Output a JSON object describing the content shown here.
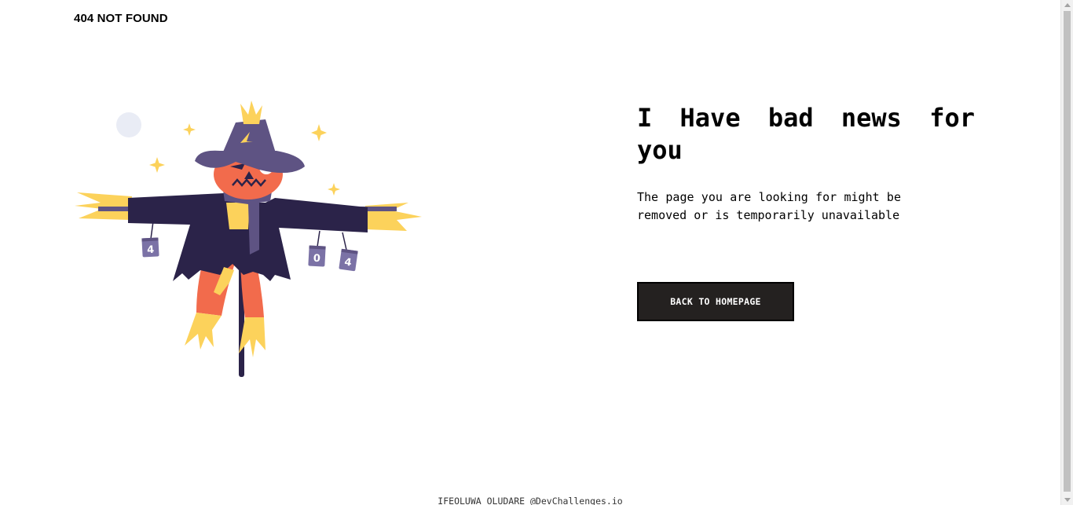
{
  "header": {
    "brand": "404 NOT FOUND"
  },
  "illustration": {
    "name": "scarecrow-illustration",
    "can_labels": [
      "4",
      "0",
      "4"
    ]
  },
  "main": {
    "headline": "I Have bad news for you",
    "message": "The page you are looking for might be removed or is temporarily unavailable",
    "cta_label": "BACK TO HOMEPAGE"
  },
  "footer": {
    "credit": "IFEOLUWA OLUDARE @DevChallenges.io"
  },
  "colors": {
    "button_bg": "#242120",
    "hat": "#5e5383",
    "coat": "#2b2349",
    "pumpkin": "#f26b4c",
    "straw": "#fcd25b",
    "moon": "#e9ecf5"
  }
}
